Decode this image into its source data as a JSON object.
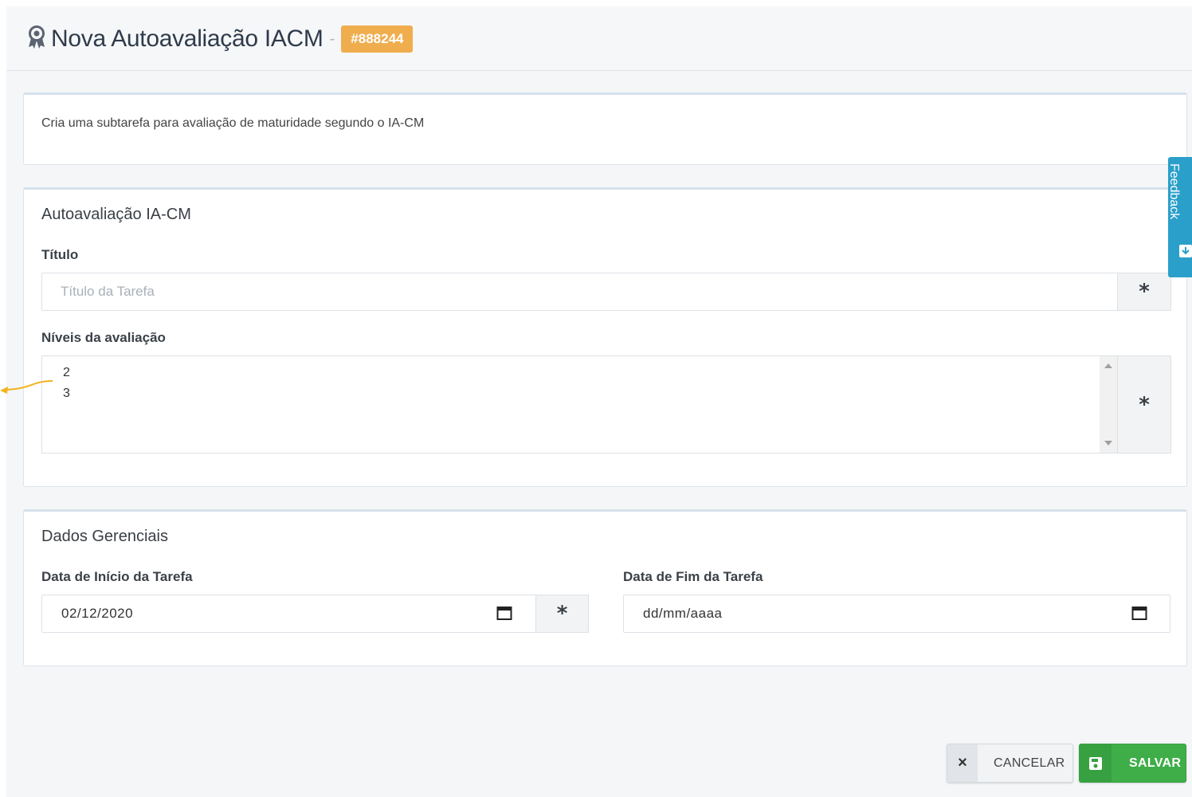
{
  "header": {
    "title": "Nova Autoavaliação IACM",
    "separator": "-",
    "badge": "#888244",
    "badge_color": "#f0ad4e",
    "icon": "award-icon"
  },
  "description": {
    "text": "Cria uma subtarefa para avaliação de maturidade segundo o IA-CM"
  },
  "autoavaliacao": {
    "title": "Autoavaliação IA-CM",
    "titulo_label": "Título",
    "titulo_placeholder": "Título da Tarefa",
    "titulo_required": "*",
    "niveis_label": "Níveis da avaliação",
    "niveis_options": [
      "2",
      "3"
    ],
    "niveis_required": "*"
  },
  "dados": {
    "title": "Dados Gerenciais",
    "inicio_label": "Data de Início da Tarefa",
    "inicio_value": "02/12/2020",
    "inicio_required": "*",
    "fim_label": "Data de Fim da Tarefa",
    "fim_placeholder": "dd/mm/aaaa"
  },
  "feedback": {
    "label": "Feedback",
    "color": "#2a9fc9"
  },
  "actions": {
    "cancel_label": "CANCELAR",
    "cancel_icon": "×",
    "save_label": "SALVAR",
    "save_color": "#3fae49"
  }
}
